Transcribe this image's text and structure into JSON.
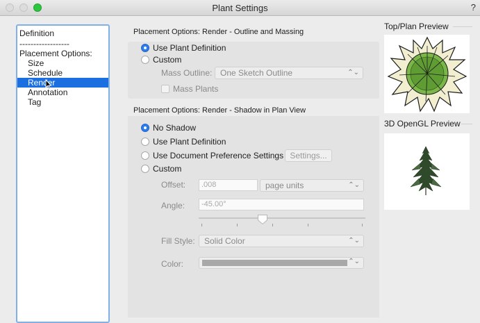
{
  "window": {
    "title": "Plant Settings",
    "help": "?"
  },
  "sidebar": {
    "items": [
      {
        "label": "Definition"
      },
      {
        "label": "------------------"
      },
      {
        "label": "Placement Options:"
      },
      {
        "label": "Size"
      },
      {
        "label": "Schedule"
      },
      {
        "label": "Render"
      },
      {
        "label": "Annotation"
      },
      {
        "label": "Tag"
      }
    ],
    "selected": "Render"
  },
  "outline_section": {
    "title": "Placement Options: Render - Outline and Massing",
    "options": [
      {
        "label": "Use Plant Definition",
        "selected": true
      },
      {
        "label": "Custom",
        "selected": false
      }
    ],
    "mass_outline_label": "Mass Outline:",
    "mass_outline_value": "One Sketch Outline",
    "mass_plants_label": "Mass Plants"
  },
  "shadow_section": {
    "title": "Placement Options: Render - Shadow in Plan View",
    "options": [
      {
        "label": "No Shadow",
        "selected": true
      },
      {
        "label": "Use Plant Definition",
        "selected": false
      },
      {
        "label": "Use Document Preference Settings",
        "selected": false
      },
      {
        "label": "Custom",
        "selected": false
      }
    ],
    "settings_button": "Settings...",
    "offset_label": "Offset:",
    "offset_value": ".008",
    "offset_units": "page units",
    "angle_label": "Angle:",
    "angle_value": "-45.00°",
    "fill_style_label": "Fill Style:",
    "fill_style_value": "Solid Color",
    "color_label": "Color:",
    "color_value": "#a8a8a8"
  },
  "previews": {
    "top_plan_title": "Top/Plan Preview",
    "opengl_title": "3D OpenGL Preview"
  },
  "colors": {
    "accent": "#1c6fe0",
    "zoom_button": "#2dc63f",
    "plan_fill": "#7ab648",
    "plan_outline": "#1a1a1a",
    "plan_rim": "#f2efd0"
  }
}
